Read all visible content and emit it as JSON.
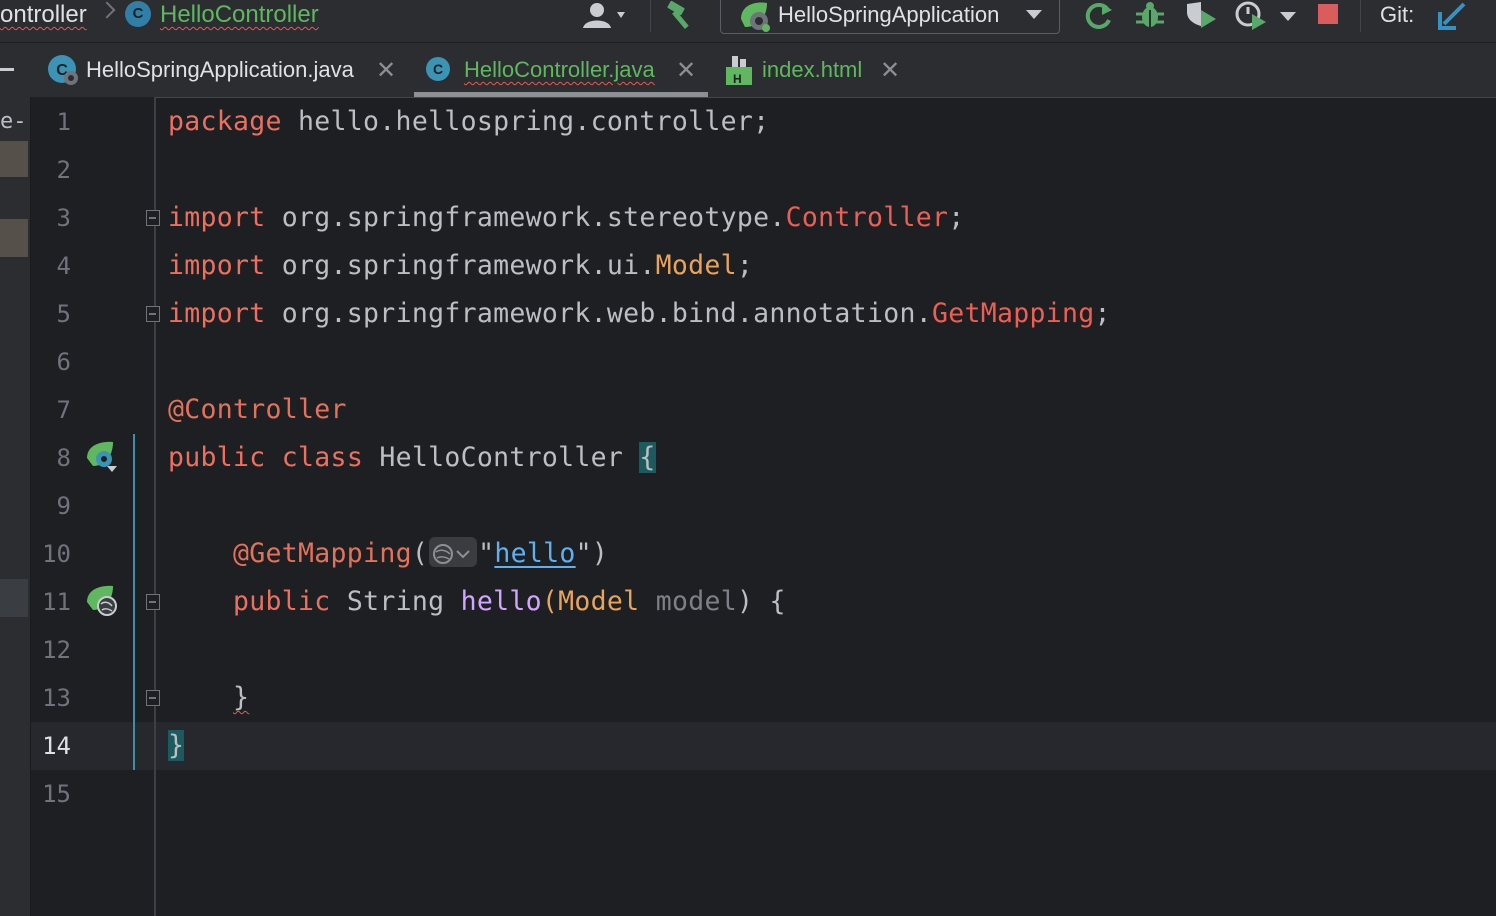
{
  "breadcrumb": {
    "parent": "ontroller",
    "current": "HelloController",
    "class_icon_letter": "C"
  },
  "toolbar": {
    "run_config": "HelloSpringApplication",
    "git_label": "Git:",
    "icons": [
      "user-menu-icon",
      "build-hammer-icon",
      "spring-app-icon",
      "rerun-icon",
      "debug-icon",
      "coverage-icon",
      "profile-icon",
      "more-dropdown-icon",
      "stop-icon",
      "git-update-icon"
    ]
  },
  "tabs": [
    {
      "label": "HelloSpringApplication.java",
      "icon": "spring-boot-icon",
      "active": false,
      "close": "✕"
    },
    {
      "label": "HelloController.java",
      "icon": "class-icon",
      "active": true,
      "close": "✕"
    },
    {
      "label": "index.html",
      "icon": "html-file-icon",
      "active": false,
      "close": "✕"
    }
  ],
  "left_strip": {
    "text": "e-"
  },
  "gutter": {
    "line_numbers": [
      "1",
      "2",
      "3",
      "4",
      "5",
      "6",
      "7",
      "8",
      "9",
      "10",
      "11",
      "12",
      "13",
      "14",
      "15"
    ],
    "current_line": "14"
  },
  "code": {
    "l1": {
      "kw": "package",
      "rest": " hello.hellospring.controller;"
    },
    "l3": {
      "kw": "import",
      "pkg": " org.springframework.stereotype.",
      "cls": "Controller",
      "end": ";"
    },
    "l4": {
      "kw": "import",
      "pkg": " org.springframework.ui.",
      "cls": "Model",
      "end": ";"
    },
    "l5": {
      "kw": "import",
      "pkg": " org.springframework.web.bind.annotation.",
      "cls": "GetMapping",
      "end": ";"
    },
    "l7": {
      "ann": "@Controller"
    },
    "l8": {
      "kw1": "public",
      "kw2": "class",
      "name": " HelloController ",
      "brace": "{"
    },
    "l10": {
      "indent": "    ",
      "ann": "@GetMapping",
      "open": "(",
      "q1": "\"",
      "str": "hello",
      "q2": "\"",
      "close": ")"
    },
    "l11": {
      "indent": "    ",
      "kw": "public",
      "type": " String ",
      "meth": "hello",
      "open": "(",
      "ptype": "Model",
      "param": " model",
      "close": ")",
      "brace": " {"
    },
    "l13": {
      "indent": "    ",
      "brace": "}"
    },
    "l14": {
      "brace": "}"
    }
  },
  "colors": {
    "keyword": "#ed6f5f",
    "class_ref": "#ed5f55",
    "type_ref": "#e8a35c",
    "method": "#d2a6ff",
    "string_link": "#5db1f2",
    "background": "#1e1f22"
  }
}
